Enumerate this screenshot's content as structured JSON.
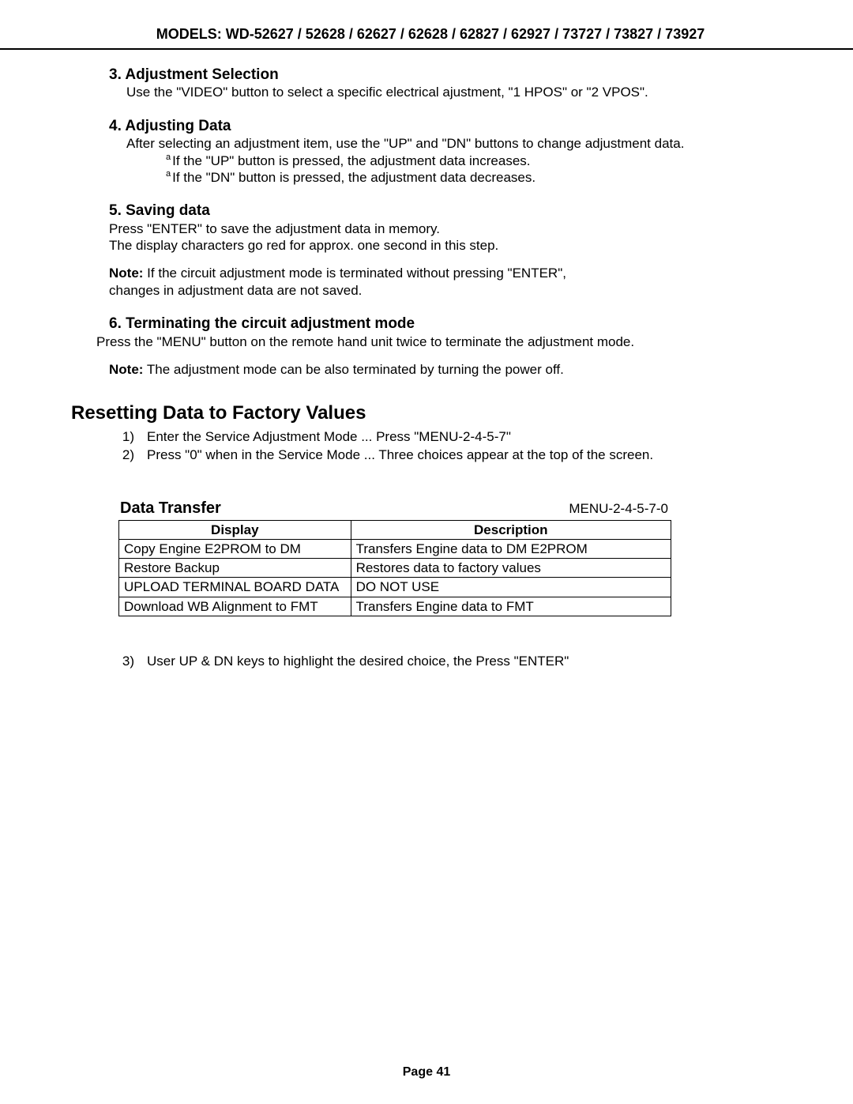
{
  "header": {
    "models_line": "MODELS: WD-52627 / 52628 / 62627 / 62628 / 62827 / 62927 / 73727 / 73827 / 73927"
  },
  "sections": {
    "s3": {
      "title": "3. Adjustment Selection",
      "body": "Use the \"VIDEO\" button to select a specific electrical ajustment,  \"1 HPOS\" or \"2 VPOS\"."
    },
    "s4": {
      "title": "4. Adjusting Data",
      "body": "After selecting an adjustment item, use the \"UP\" and \"DN\" buttons to change adjustment data.",
      "bullet_a": "If the \"UP\" button is pressed, the adjustment data increases.",
      "bullet_b": "If the \"DN\" button is pressed, the adjustment data decreases."
    },
    "s5": {
      "title": "5. Saving data",
      "line1": " Press \"ENTER\" to save the adjustment data in memory.",
      "line2": "The display characters go red for approx. one second in this step.",
      "note_label": "Note:",
      "note_text": " If the circuit adjustment mode is terminated without pressing  \"ENTER\", changes in adjustment data are not saved."
    },
    "s6": {
      "title": "6. Terminating the circuit adjustment mode",
      "body": "Press the \"MENU\" button on the remote hand unit twice to terminate the adjustment mode.",
      "note_label": "Note:",
      "note_text": " The adjustment mode can be also terminated by turning the power off."
    }
  },
  "reset": {
    "title": "Resetting Data to Factory Values",
    "items": [
      {
        "n": "1)",
        "t": "Enter the Service Adjustment Mode ... Press \"MENU-2-4-5-7\""
      },
      {
        "n": "2)",
        "t": "Press \"0\" when in the Service Mode ... Three choices appear at the top of the screen."
      }
    ],
    "after_item": {
      "n": "3)",
      "t": "User UP & DN keys to highlight the desired choice, the Press \"ENTER\""
    }
  },
  "table": {
    "title": "Data Transfer",
    "menu_code": "MENU-2-4-5-7-0",
    "headers": {
      "display": "Display",
      "description": "Description"
    },
    "rows": [
      {
        "display": "Copy Engine E2PROM to DM",
        "description": "Transfers Engine data  to DM E2PROM"
      },
      {
        "display": "Restore Backup",
        "description": "Restores data to factory values"
      },
      {
        "display": "UPLOAD TERMINAL BOARD DATA",
        "description": "DO NOT USE"
      },
      {
        "display": "Download WB Alignment to FMT",
        "description": "Transfers Engine data  to FMT"
      }
    ]
  },
  "footer": {
    "page_label": "Page 41"
  }
}
